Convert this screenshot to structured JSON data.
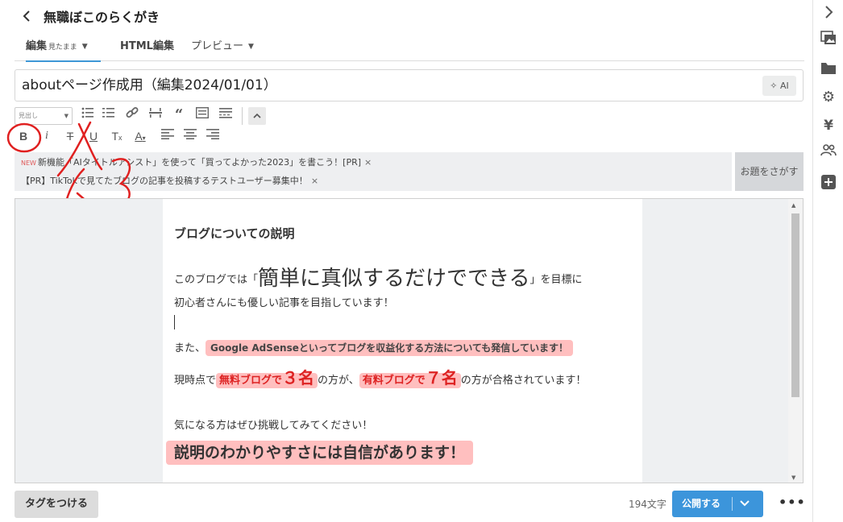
{
  "header": {
    "back_icon": "chevron-left-icon",
    "title": "無職ぼこのらくがき"
  },
  "tabs": [
    {
      "label": "編集",
      "sub": "見たまま",
      "active": true
    },
    {
      "label": "HTML編集",
      "active": false
    },
    {
      "label": "プレビュー",
      "active": false
    }
  ],
  "post": {
    "title": "aboutページ作成用（編集2024/01/01）"
  },
  "ai_button": {
    "label": "AI"
  },
  "toolbar": {
    "font_select_value": "見出し"
  },
  "annotation": {
    "label": "太字"
  },
  "notices": [
    {
      "badge": "NEW",
      "text": "新機能「AIタイトルアシスト」を使って「買ってよかった2023」を書こう！[PR]"
    },
    {
      "badge": "",
      "text": "【PR】TikTokで見てたブログの記事を投稿するテストユーザー募集中！"
    }
  ],
  "topic_button": {
    "label": "お題をさがす"
  },
  "content": {
    "heading": "ブログについての説明",
    "line1_pre": "このブログでは「",
    "line1_big": "簡単に真似するだけでできる",
    "line1_post": "」を目標に",
    "line2": "初心者さんにも優しい記事を目指しています！",
    "line3_pre": "また、",
    "line3_hl": "Google AdSenseといってブログを収益化する方法についても発信しています！",
    "line4_a": "現時点で",
    "line4_b": "無料ブログで",
    "line4_c": "３名",
    "line4_d": "の方が、",
    "line4_e": "有料ブログで",
    "line4_f": "７名",
    "line4_g": "の方が合格されています！",
    "line5": "気になる方はぜひ挑戦してみてください！",
    "line6": "説明のわかりやすさには自信があります！"
  },
  "footer": {
    "tag_button": "タグをつける",
    "char_count": "194文字",
    "publish": "公開する",
    "more": "•••"
  },
  "colors": {
    "accent": "#3c95db",
    "highlight": "#ffaaaa",
    "annotation_red": "#e02020",
    "emphasis_red": "#dd2222"
  }
}
